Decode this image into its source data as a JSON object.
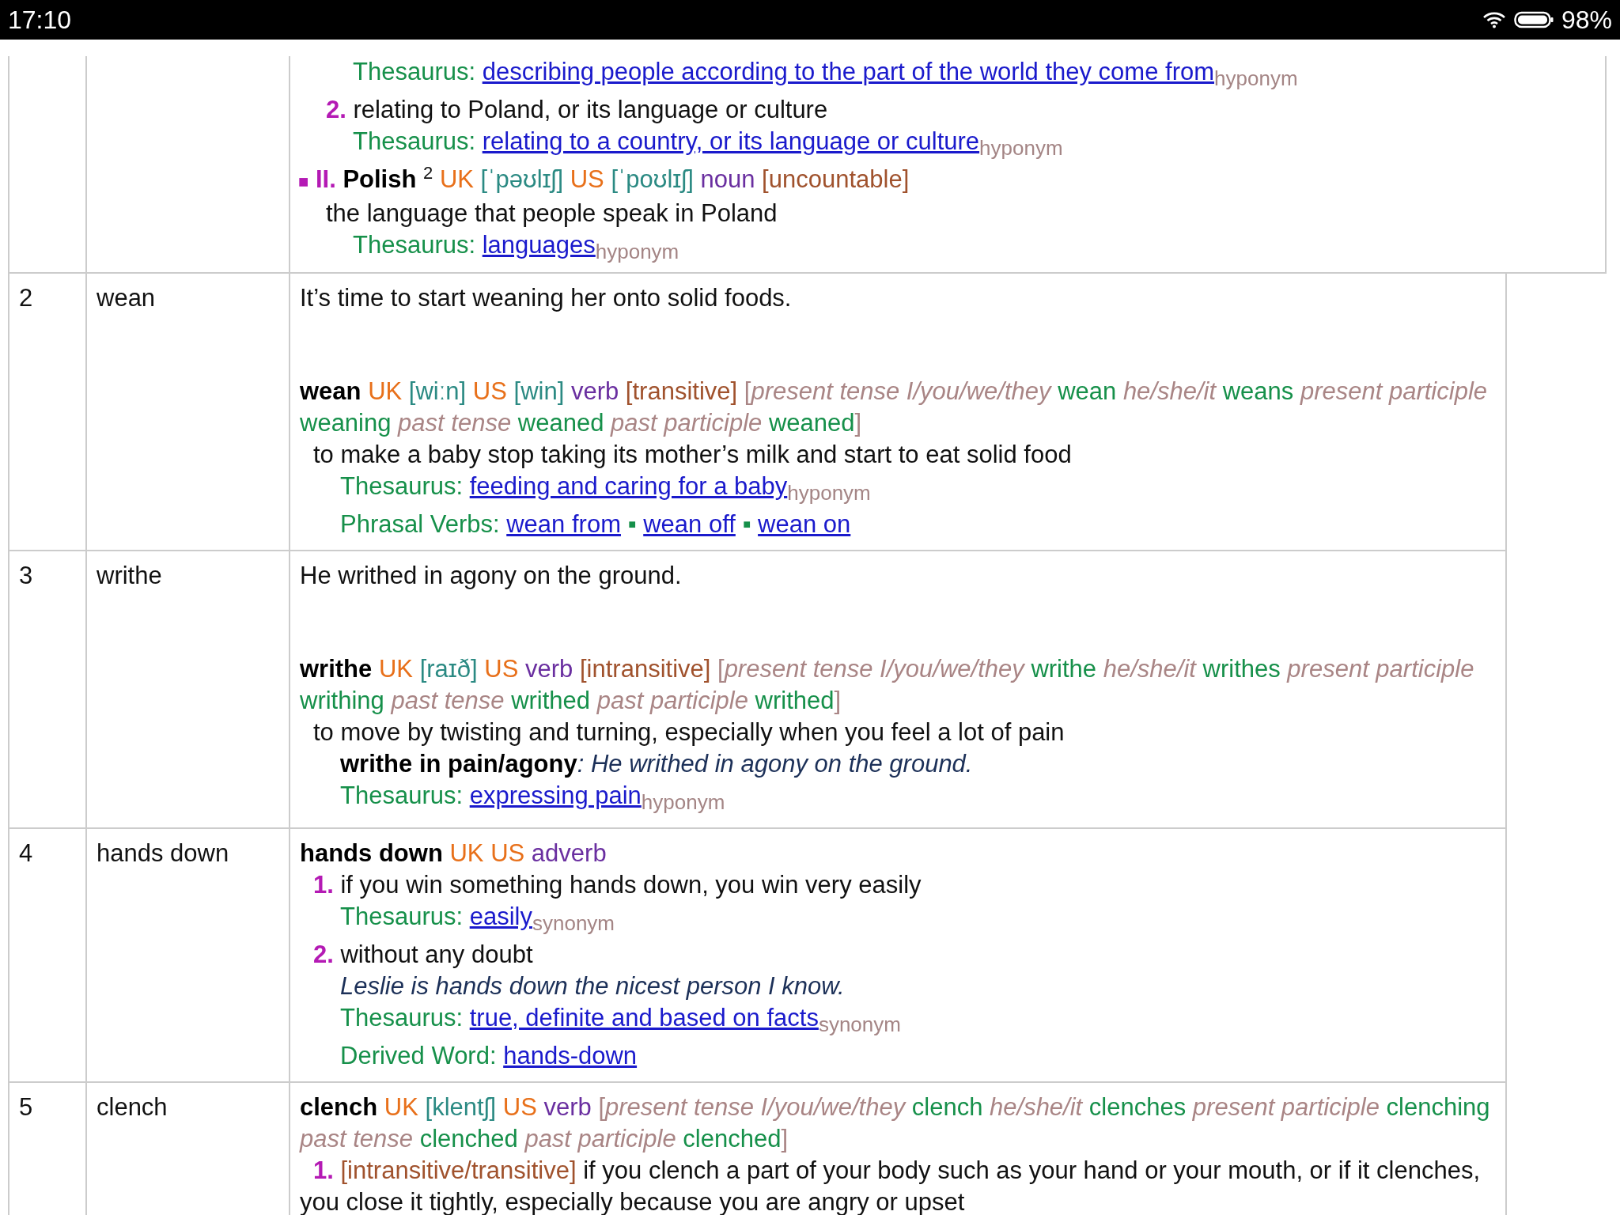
{
  "status_bar": {
    "time": "17:10",
    "battery": "98%"
  },
  "continued_entry": {
    "lines": [
      {
        "kind": "thes",
        "segments": [
          {
            "kind": "label",
            "text": "Thesaurus:"
          },
          {
            "kind": "link",
            "text": "describing people according to the part of the world they come from"
          },
          {
            "kind": "rel",
            "text": "hyponym"
          }
        ]
      },
      {
        "kind": "def",
        "segments": [
          {
            "kind": "num",
            "text": "2."
          },
          {
            "kind": "text",
            "text": "relating to Poland, or its language or culture"
          }
        ]
      },
      {
        "kind": "thes",
        "segments": [
          {
            "kind": "label",
            "text": "Thesaurus:"
          },
          {
            "kind": "link",
            "text": "relating to a country, or its language or culture"
          },
          {
            "kind": "rel",
            "text": "hyponym"
          }
        ]
      },
      {
        "kind": "sense",
        "segments": [
          {
            "kind": "bullet",
            "text": "■"
          },
          {
            "kind": "num",
            "text": "II."
          },
          {
            "kind": "headword",
            "text": "Polish"
          },
          {
            "kind": "sup",
            "text": "2"
          },
          {
            "kind": "region",
            "text": "UK"
          },
          {
            "kind": "pron",
            "text": "[ˈpəʊlɪʃ]"
          },
          {
            "kind": "region",
            "text": "US"
          },
          {
            "kind": "pron",
            "text": "[ˈpoʊlɪʃ]"
          },
          {
            "kind": "pos",
            "text": "noun"
          },
          {
            "kind": "gram",
            "text": "[uncountable]"
          }
        ]
      },
      {
        "kind": "def",
        "segments": [
          {
            "kind": "text",
            "text": "the language that people speak in Poland"
          }
        ]
      },
      {
        "kind": "thes",
        "segments": [
          {
            "kind": "label",
            "text": "Thesaurus:"
          },
          {
            "kind": "link",
            "text": "languages"
          },
          {
            "kind": "rel",
            "text": "hyponym"
          }
        ]
      }
    ]
  },
  "rows": [
    {
      "number": "2",
      "word": "wean",
      "example": "It’s time to start weaning her onto solid foods.",
      "lines": [
        {
          "kind": "head",
          "segments": [
            {
              "kind": "headword",
              "text": "wean"
            },
            {
              "kind": "region",
              "text": "UK"
            },
            {
              "kind": "pron",
              "text": "[wiːn]"
            },
            {
              "kind": "region",
              "text": "US"
            },
            {
              "kind": "pron",
              "text": "[win]"
            },
            {
              "kind": "pos",
              "text": "verb"
            },
            {
              "kind": "gram",
              "text": "[transitive]"
            },
            {
              "kind": "inflection",
              "parts": [
                {
                  "kind": "open",
                  "text": "["
                },
                {
                  "kind": "label",
                  "text": "present tense I/you/we/they"
                },
                {
                  "kind": "form",
                  "text": "wean"
                },
                {
                  "kind": "label",
                  "text": "he/she/it"
                },
                {
                  "kind": "form",
                  "text": "weans"
                },
                {
                  "kind": "label",
                  "text": "present participle"
                },
                {
                  "kind": "form",
                  "text": "weaning"
                },
                {
                  "kind": "label",
                  "text": "past tense"
                },
                {
                  "kind": "form",
                  "text": "weaned"
                },
                {
                  "kind": "label",
                  "text": "past participle"
                },
                {
                  "kind": "form",
                  "text": "weaned"
                },
                {
                  "kind": "close",
                  "text": "]"
                }
              ]
            }
          ]
        },
        {
          "kind": "def",
          "segments": [
            {
              "kind": "text",
              "text": "to make a baby stop taking its mother’s milk and start to eat solid food"
            }
          ]
        },
        {
          "kind": "thes",
          "segments": [
            {
              "kind": "label",
              "text": "Thesaurus:"
            },
            {
              "kind": "link",
              "text": "feeding and caring for a baby"
            },
            {
              "kind": "rel",
              "text": "hyponym"
            }
          ]
        },
        {
          "kind": "sub",
          "segments": [
            {
              "kind": "label",
              "text": "Phrasal Verbs:"
            },
            {
              "kind": "link",
              "text": "wean from"
            },
            {
              "kind": "sep",
              "text": "▪"
            },
            {
              "kind": "link",
              "text": "wean off"
            },
            {
              "kind": "sep",
              "text": "▪"
            },
            {
              "kind": "link",
              "text": "wean on"
            }
          ]
        }
      ]
    },
    {
      "number": "3",
      "word": "writhe",
      "example": "He writhed in agony on the ground.",
      "lines": [
        {
          "kind": "head",
          "segments": [
            {
              "kind": "headword",
              "text": "writhe"
            },
            {
              "kind": "region",
              "text": "UK"
            },
            {
              "kind": "pron",
              "text": "[raɪð]"
            },
            {
              "kind": "region",
              "text": "US"
            },
            {
              "kind": "pos",
              "text": "verb"
            },
            {
              "kind": "gram",
              "text": "[intransitive]"
            },
            {
              "kind": "inflection",
              "parts": [
                {
                  "kind": "open",
                  "text": "["
                },
                {
                  "kind": "label",
                  "text": "present tense I/you/we/they"
                },
                {
                  "kind": "form",
                  "text": "writhe"
                },
                {
                  "kind": "label",
                  "text": "he/she/it"
                },
                {
                  "kind": "form",
                  "text": "writhes"
                },
                {
                  "kind": "label",
                  "text": "present participle"
                },
                {
                  "kind": "form",
                  "text": "writhing"
                },
                {
                  "kind": "label",
                  "text": "past tense"
                },
                {
                  "kind": "form",
                  "text": "writhed"
                },
                {
                  "kind": "label",
                  "text": "past participle"
                },
                {
                  "kind": "form",
                  "text": "writhed"
                },
                {
                  "kind": "close",
                  "text": "]"
                }
              ]
            }
          ]
        },
        {
          "kind": "def",
          "segments": [
            {
              "kind": "text",
              "text": "to move by twisting and turning, especially when you feel a lot of pain"
            }
          ]
        },
        {
          "kind": "sub",
          "segments": [
            {
              "kind": "phrase",
              "text": "writhe in pain/agony"
            },
            {
              "kind": "example",
              "text": ": He writhed in agony on the ground."
            }
          ]
        },
        {
          "kind": "thes",
          "segments": [
            {
              "kind": "label",
              "text": "Thesaurus:"
            },
            {
              "kind": "link",
              "text": "expressing pain"
            },
            {
              "kind": "rel",
              "text": "hyponym"
            }
          ]
        }
      ]
    },
    {
      "number": "4",
      "word": "hands down",
      "lines": [
        {
          "kind": "head",
          "segments": [
            {
              "kind": "headword",
              "text": "hands down"
            },
            {
              "kind": "region",
              "text": "UK"
            },
            {
              "kind": "region",
              "text": "US"
            },
            {
              "kind": "pos",
              "text": "adverb"
            }
          ]
        },
        {
          "kind": "def",
          "segments": [
            {
              "kind": "num",
              "text": "1."
            },
            {
              "kind": "text",
              "text": "if you win something hands down, you win very easily"
            }
          ]
        },
        {
          "kind": "thes",
          "segments": [
            {
              "kind": "label",
              "text": "Thesaurus:"
            },
            {
              "kind": "link",
              "text": "easily"
            },
            {
              "kind": "rel",
              "text": "synonym"
            }
          ]
        },
        {
          "kind": "def",
          "segments": [
            {
              "kind": "num",
              "text": "2."
            },
            {
              "kind": "text",
              "text": "without any doubt"
            }
          ]
        },
        {
          "kind": "sub",
          "segments": [
            {
              "kind": "example",
              "text": "Leslie is hands down the nicest person I know."
            }
          ]
        },
        {
          "kind": "thes",
          "segments": [
            {
              "kind": "label",
              "text": "Thesaurus:"
            },
            {
              "kind": "link",
              "text": "true, definite and based on facts"
            },
            {
              "kind": "rel",
              "text": "synonym"
            }
          ]
        },
        {
          "kind": "sub",
          "segments": [
            {
              "kind": "label",
              "text": "Derived Word:"
            },
            {
              "kind": "link",
              "text": "hands-down"
            }
          ]
        }
      ]
    },
    {
      "number": "5",
      "word": "clench",
      "lines": [
        {
          "kind": "head",
          "segments": [
            {
              "kind": "headword",
              "text": "clench"
            },
            {
              "kind": "region",
              "text": "UK"
            },
            {
              "kind": "pron",
              "text": "[klentʃ]"
            },
            {
              "kind": "region",
              "text": "US"
            },
            {
              "kind": "pos",
              "text": "verb"
            },
            {
              "kind": "inflection",
              "parts": [
                {
                  "kind": "open",
                  "text": "["
                },
                {
                  "kind": "label",
                  "text": "present tense I/you/we/they"
                },
                {
                  "kind": "form",
                  "text": "clench"
                },
                {
                  "kind": "label",
                  "text": "he/she/it"
                },
                {
                  "kind": "form",
                  "text": "clenches"
                },
                {
                  "kind": "label",
                  "text": "present participle"
                },
                {
                  "kind": "form",
                  "text": "clenching"
                },
                {
                  "kind": "label",
                  "text": "past tense"
                },
                {
                  "kind": "form",
                  "text": "clenched"
                },
                {
                  "kind": "label",
                  "text": "past participle"
                },
                {
                  "kind": "form",
                  "text": "clenched"
                },
                {
                  "kind": "close",
                  "text": "]"
                }
              ]
            }
          ]
        },
        {
          "kind": "def",
          "segments": [
            {
              "kind": "num",
              "text": "1."
            },
            {
              "kind": "gram",
              "text": "[intransitive/transitive]"
            },
            {
              "kind": "text",
              "text": "if you clench a part of your body such as your hand or your mouth, or if it clenches, you close it tightly, especially because you are angry or upset"
            }
          ]
        }
      ]
    }
  ]
}
